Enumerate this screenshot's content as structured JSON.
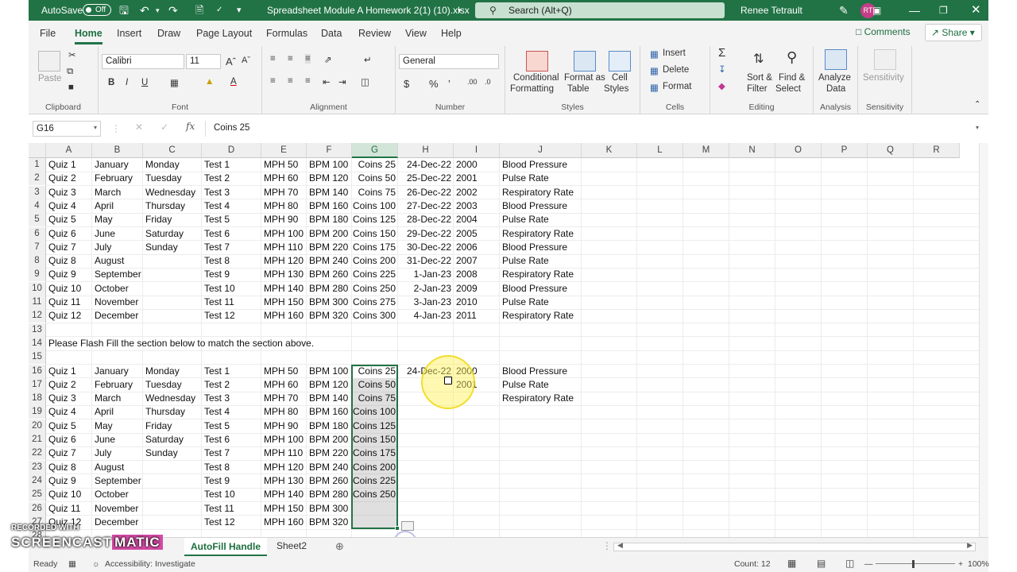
{
  "title_bar": {
    "autosave_label": "AutoSave",
    "autosave_state": "Off",
    "doc_title": "Spreadsheet Module A Homework 2(1) (10).xlsx",
    "search_placeholder": "Search (Alt+Q)",
    "user_name": "Renee Tetrault",
    "user_initials": "RT"
  },
  "menu": {
    "items": [
      "File",
      "Home",
      "Insert",
      "Draw",
      "Page Layout",
      "Formulas",
      "Data",
      "Review",
      "View",
      "Help"
    ],
    "active": "Home",
    "comments_label": "Comments",
    "share_label": "Share"
  },
  "ribbon": {
    "clipboard": {
      "paste": "Paste",
      "label": "Clipboard"
    },
    "font": {
      "name": "Calibri",
      "size": "11",
      "label": "Font"
    },
    "alignment": {
      "label": "Alignment"
    },
    "number": {
      "format": "General",
      "label": "Number"
    },
    "styles": {
      "conditional_1": "Conditional",
      "conditional_2": "Formatting",
      "format_table_1": "Format as",
      "format_table_2": "Table",
      "cell_styles_1": "Cell",
      "cell_styles_2": "Styles",
      "label": "Styles"
    },
    "cells": {
      "insert": "Insert",
      "delete": "Delete",
      "format": "Format",
      "label": "Cells"
    },
    "editing": {
      "sort_1": "Sort &",
      "sort_2": "Filter",
      "find_1": "Find &",
      "find_2": "Select",
      "label": "Editing"
    },
    "analysis": {
      "analyze_1": "Analyze",
      "analyze_2": "Data",
      "label": "Analysis"
    },
    "sensitivity": {
      "button": "Sensitivity",
      "label": "Sensitivity"
    }
  },
  "formula_bar": {
    "name_box": "G16",
    "fx": "fx",
    "value": "Coins 25"
  },
  "grid": {
    "columns": [
      "A",
      "B",
      "C",
      "D",
      "E",
      "F",
      "G",
      "H",
      "I",
      "J",
      "K",
      "L",
      "M",
      "N",
      "O",
      "P",
      "Q",
      "R"
    ],
    "selected_column": "G",
    "row_numbers": [
      "1",
      "2",
      "3",
      "4",
      "5",
      "6",
      "7",
      "8",
      "9",
      "10",
      "11",
      "12",
      "13",
      "14",
      "15",
      "16",
      "17",
      "18",
      "19",
      "20",
      "21",
      "22",
      "23",
      "24",
      "25",
      "26",
      "27",
      "28"
    ],
    "rows_top": [
      [
        "Quiz 1",
        "January",
        "Monday",
        "Test 1",
        "MPH 50",
        "BPM 100",
        "Coins 25",
        "24-Dec-22",
        "2000",
        "Blood Pressure"
      ],
      [
        "Quiz 2",
        "February",
        "Tuesday",
        "Test 2",
        "MPH 60",
        "BPM 120",
        "Coins 50",
        "25-Dec-22",
        "2001",
        "Pulse Rate"
      ],
      [
        "Quiz 3",
        "March",
        "Wednesday",
        "Test 3",
        "MPH 70",
        "BPM 140",
        "Coins 75",
        "26-Dec-22",
        "2002",
        "Respiratory Rate"
      ],
      [
        "Quiz 4",
        "April",
        "Thursday",
        "Test 4",
        "MPH 80",
        "BPM 160",
        "Coins 100",
        "27-Dec-22",
        "2003",
        "Blood Pressure"
      ],
      [
        "Quiz 5",
        "May",
        "Friday",
        "Test 5",
        "MPH 90",
        "BPM 180",
        "Coins 125",
        "28-Dec-22",
        "2004",
        "Pulse Rate"
      ],
      [
        "Quiz 6",
        "June",
        "Saturday",
        "Test 6",
        "MPH 100",
        "BPM 200",
        "Coins 150",
        "29-Dec-22",
        "2005",
        "Respiratory Rate"
      ],
      [
        "Quiz 7",
        "July",
        "Sunday",
        "Test 7",
        "MPH 110",
        "BPM 220",
        "Coins 175",
        "30-Dec-22",
        "2006",
        "Blood Pressure"
      ],
      [
        "Quiz 8",
        "August",
        "",
        "Test 8",
        "MPH 120",
        "BPM 240",
        "Coins 200",
        "31-Dec-22",
        "2007",
        "Pulse Rate"
      ],
      [
        "Quiz 9",
        "September",
        "",
        "Test 9",
        "MPH 130",
        "BPM 260",
        "Coins 225",
        "1-Jan-23",
        "2008",
        "Respiratory Rate"
      ],
      [
        "Quiz 10",
        "October",
        "",
        "Test 10",
        "MPH 140",
        "BPM 280",
        "Coins 250",
        "2-Jan-23",
        "2009",
        "Blood Pressure"
      ],
      [
        "Quiz 11",
        "November",
        "",
        "Test 11",
        "MPH 150",
        "BPM 300",
        "Coins 275",
        "3-Jan-23",
        "2010",
        "Pulse Rate"
      ],
      [
        "Quiz 12",
        "December",
        "",
        "Test 12",
        "MPH 160",
        "BPM 320",
        "Coins 300",
        "4-Jan-23",
        "2011",
        "Respiratory Rate"
      ]
    ],
    "instruction": "Please Flash Fill the section below to match the section above.",
    "rows_bottom": [
      [
        "Quiz 1",
        "January",
        "Monday",
        "Test 1",
        "MPH 50",
        "BPM 100",
        "Coins 25",
        "24-Dec-22",
        "2000",
        "Blood Pressure"
      ],
      [
        "Quiz 2",
        "February",
        "Tuesday",
        "Test 2",
        "MPH 60",
        "BPM 120",
        "Coins 50",
        "",
        "2001",
        "Pulse Rate"
      ],
      [
        "Quiz 3",
        "March",
        "Wednesday",
        "Test 3",
        "MPH 70",
        "BPM 140",
        "Coins 75",
        "",
        "",
        "Respiratory Rate"
      ],
      [
        "Quiz 4",
        "April",
        "Thursday",
        "Test 4",
        "MPH 80",
        "BPM 160",
        "Coins 100",
        "",
        "",
        ""
      ],
      [
        "Quiz 5",
        "May",
        "Friday",
        "Test 5",
        "MPH 90",
        "BPM 180",
        "Coins 125",
        "",
        "",
        ""
      ],
      [
        "Quiz 6",
        "June",
        "Saturday",
        "Test 6",
        "MPH 100",
        "BPM 200",
        "Coins 150",
        "",
        "",
        ""
      ],
      [
        "Quiz 7",
        "July",
        "Sunday",
        "Test 7",
        "MPH 110",
        "BPM 220",
        "Coins 175",
        "",
        "",
        ""
      ],
      [
        "Quiz 8",
        "August",
        "",
        "Test 8",
        "MPH 120",
        "BPM 240",
        "Coins 200",
        "",
        "",
        ""
      ],
      [
        "Quiz 9",
        "September",
        "",
        "Test 9",
        "MPH 130",
        "BPM 260",
        "Coins 225",
        "",
        "",
        ""
      ],
      [
        "Quiz 10",
        "October",
        "",
        "Test 10",
        "MPH 140",
        "BPM 280",
        "Coins 250",
        "",
        "",
        ""
      ],
      [
        "Quiz 11",
        "November",
        "",
        "Test 11",
        "MPH 150",
        "BPM 300",
        "",
        "",
        "",
        ""
      ],
      [
        "Quiz 12",
        "December",
        "",
        "Test 12",
        "MPH 160",
        "BPM 320",
        "",
        "",
        "",
        ""
      ]
    ]
  },
  "sheets": {
    "tabs": [
      "AutoFill Handle",
      "Sheet2"
    ],
    "active": "AutoFill Handle"
  },
  "status": {
    "ready": "Ready",
    "accessibility": "Accessibility: Investigate",
    "count": "Count: 12",
    "zoom": "100%"
  },
  "watermark": {
    "line1": "RECORDED WITH",
    "line2a": "SCREENCAST",
    "line2b": "MATIC"
  },
  "colors": {
    "accent": "#217346"
  }
}
